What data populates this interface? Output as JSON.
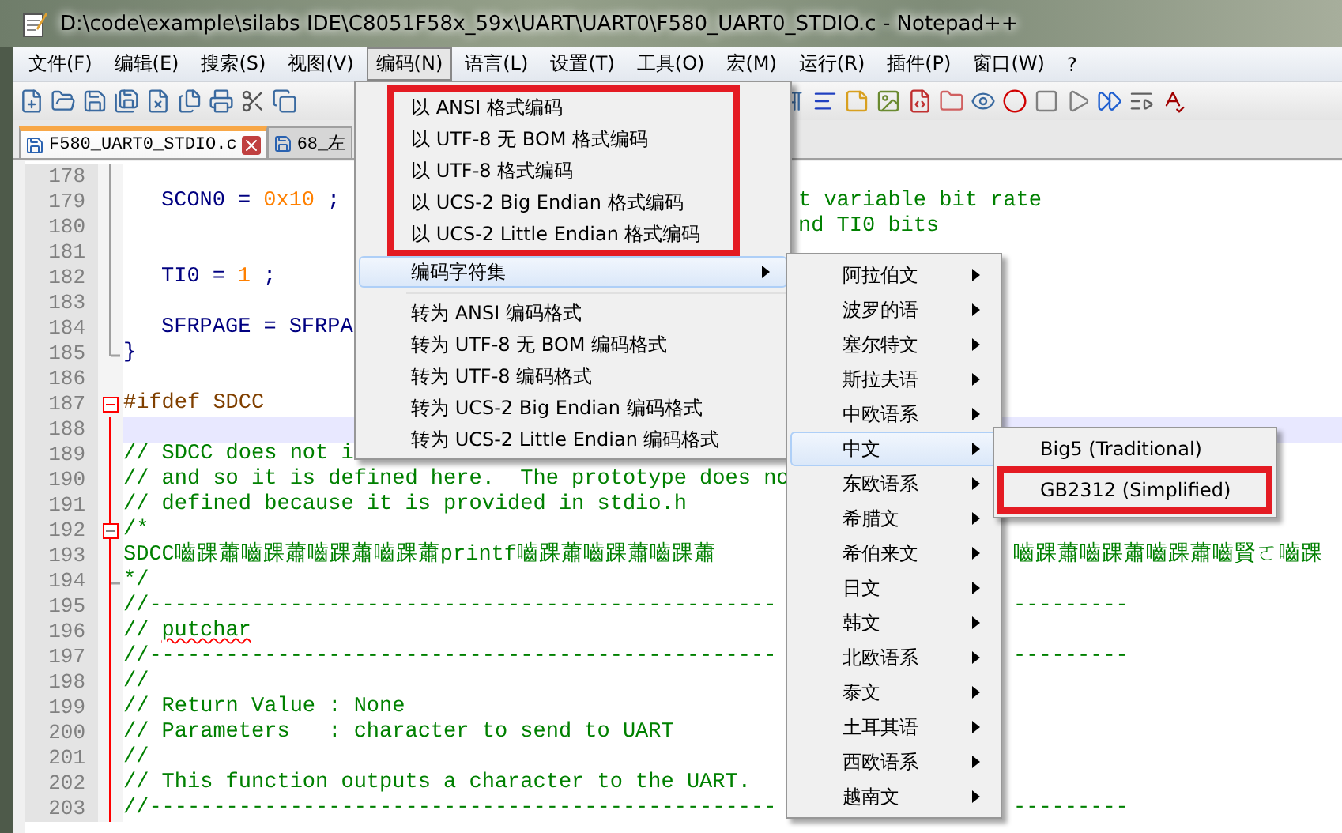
{
  "window": {
    "title": "D:\\code\\example\\silabs IDE\\C8051F58x_59x\\UART\\UART0\\F580_UART0_STDIO.c - Notepad++"
  },
  "menu_bar": [
    {
      "label": "文件(F)",
      "selected": false
    },
    {
      "label": "编辑(E)",
      "selected": false
    },
    {
      "label": "搜索(S)",
      "selected": false
    },
    {
      "label": "视图(V)",
      "selected": false
    },
    {
      "label": "编码(N)",
      "selected": true
    },
    {
      "label": "语言(L)",
      "selected": false
    },
    {
      "label": "设置(T)",
      "selected": false
    },
    {
      "label": "工具(O)",
      "selected": false
    },
    {
      "label": "宏(M)",
      "selected": false
    },
    {
      "label": "运行(R)",
      "selected": false
    },
    {
      "label": "插件(P)",
      "selected": false
    },
    {
      "label": "窗口(W)",
      "selected": false
    },
    {
      "label": "?",
      "selected": false
    }
  ],
  "tabs": [
    {
      "label": "F580_UART0_STDIO.c",
      "selected": true
    },
    {
      "label": "68_左",
      "selected": false
    }
  ],
  "editor": {
    "body_lines": [
      {
        "number": "178",
        "kind": "bar"
      },
      {
        "number": "179",
        "kind": "bar",
        "segments": [
          {
            "kind": "plain",
            "text": "SCON0"
          },
          {
            "kind": "op",
            "text": "="
          },
          {
            "kind": "number",
            "text": "0x10"
          },
          {
            "kind": "op",
            "text": ";"
          }
        ],
        "after_menu": [
          {
            "kind": "comment",
            "text": "t variable bit rate"
          }
        ]
      },
      {
        "number": "180",
        "kind": "bar",
        "after_menu": [
          {
            "kind": "comment",
            "text": "nd TI0 bits"
          }
        ]
      },
      {
        "number": "181",
        "kind": "bar"
      },
      {
        "number": "182",
        "kind": "bar",
        "segments": [
          {
            "kind": "plain",
            "text": "TI0"
          },
          {
            "kind": "op",
            "text": "="
          },
          {
            "kind": "number",
            "text": "1"
          },
          {
            "kind": "op",
            "text": ";"
          }
        ]
      },
      {
        "number": "183",
        "kind": "bar"
      },
      {
        "number": "184",
        "kind": "bar",
        "segments": [
          {
            "kind": "plain",
            "text": "SFRPAGE"
          },
          {
            "kind": "op",
            "text": "="
          },
          {
            "kind": "plain",
            "text": "SFRPA"
          }
        ]
      }
    ],
    "lines": [
      {
        "number": "185",
        "kind": "end",
        "segments": [
          {
            "kind": "op",
            "text": "}"
          }
        ]
      },
      {
        "number": "186",
        "kind": "plain"
      },
      {
        "number": "187",
        "kind": "box",
        "segments": [
          {
            "kind": "preproc",
            "text": "#ifdef SDCC"
          }
        ]
      },
      {
        "number": "188",
        "kind": "hot",
        "current": true
      },
      {
        "number": "189",
        "kind": "hot",
        "segments": [
          {
            "kind": "comment",
            "text": "// SDCC does not i"
          }
        ]
      },
      {
        "number": "190",
        "kind": "hot",
        "segments": [
          {
            "kind": "comment",
            "text": "// and so it is defined here.  The prototype does no"
          }
        ]
      },
      {
        "number": "191",
        "kind": "hot",
        "segments": [
          {
            "kind": "comment",
            "text": "// defined because it is provided in stdio.h"
          }
        ]
      },
      {
        "number": "192",
        "kind": "hotbox",
        "segments": [
          {
            "kind": "comment",
            "text": "/*"
          }
        ]
      },
      {
        "number": "193",
        "kind": "hot",
        "segments": [
          {
            "kind": "comment",
            "text": "SDCC嚙踝蕭嚙踝蕭嚙踝蕭嚙踝蕭printf嚙踝蕭嚙踝蕭嚙踝蕭"
          }
        ],
        "after_submenu": [
          {
            "kind": "comment",
            "text": "嚙踝蕭嚙踝蕭嚙踝蕭嚙賢ㄛ嚙踝"
          }
        ]
      },
      {
        "number": "194",
        "kind": "hotend",
        "segments": [
          {
            "kind": "comment",
            "text": "*/"
          }
        ]
      },
      {
        "number": "195",
        "kind": "hot",
        "segments": [
          {
            "kind": "comment",
            "text": "//-------------------------------------------------"
          }
        ],
        "after_submenu": [
          {
            "kind": "comment",
            "text": "---------"
          }
        ]
      },
      {
        "number": "196",
        "kind": "hot",
        "segments": [
          {
            "kind": "comment",
            "text": "//"
          },
          {
            "kind": "misspelled",
            "text": "putchar"
          }
        ]
      },
      {
        "number": "197",
        "kind": "hot",
        "segments": [
          {
            "kind": "comment",
            "text": "//-------------------------------------------------"
          }
        ],
        "after_submenu": [
          {
            "kind": "comment",
            "text": "---------"
          }
        ]
      },
      {
        "number": "198",
        "kind": "hot",
        "segments": [
          {
            "kind": "comment",
            "text": "//"
          }
        ]
      },
      {
        "number": "199",
        "kind": "hot",
        "segments": [
          {
            "kind": "comment",
            "text": "// Return Value : None"
          }
        ]
      },
      {
        "number": "200",
        "kind": "hot",
        "segments": [
          {
            "kind": "comment",
            "text": "// Parameters   : character to send to UART"
          }
        ]
      },
      {
        "number": "201",
        "kind": "hot",
        "segments": [
          {
            "kind": "comment",
            "text": "//"
          }
        ]
      },
      {
        "number": "202",
        "kind": "hot",
        "segments": [
          {
            "kind": "comment",
            "text": "// This function outputs a character to the UART."
          }
        ]
      },
      {
        "number": "203",
        "kind": "hot",
        "segments": [
          {
            "kind": "comment",
            "text": "//-------------------------------------------------"
          }
        ],
        "after_submenu": [
          {
            "kind": "comment",
            "text": "---------"
          }
        ]
      }
    ]
  },
  "encoding_menu": {
    "items": [
      {
        "kind": "item",
        "label": "以 ANSI 格式编码",
        "highlighted": false,
        "framed": true
      },
      {
        "kind": "item",
        "label": "以 UTF-8 无 BOM 格式编码",
        "highlighted": false,
        "framed": true
      },
      {
        "kind": "item",
        "label": "以 UTF-8 格式编码",
        "highlighted": false,
        "framed": true
      },
      {
        "kind": "item",
        "label": "以 UCS-2 Big Endian 格式编码",
        "highlighted": false,
        "framed": true
      },
      {
        "kind": "item",
        "label": "以 UCS-2 Little Endian 格式编码",
        "highlighted": false,
        "framed": true
      },
      {
        "kind": "submenu",
        "label": "编码字符集",
        "highlighted": true,
        "framed": false
      },
      {
        "kind": "separator"
      },
      {
        "kind": "item",
        "label": "转为 ANSI 编码格式",
        "highlighted": false,
        "framed": false
      },
      {
        "kind": "item",
        "label": "转为 UTF-8 无 BOM 编码格式",
        "highlighted": false,
        "framed": false
      },
      {
        "kind": "item",
        "label": "转为 UTF-8 编码格式",
        "highlighted": false,
        "framed": false
      },
      {
        "kind": "item",
        "label": "转为 UCS-2 Big Endian 编码格式",
        "highlighted": false,
        "framed": false
      },
      {
        "kind": "item",
        "label": "转为 UCS-2 Little Endian 编码格式",
        "highlighted": false,
        "framed": false
      }
    ]
  },
  "charset_submenu": {
    "items": [
      {
        "kind": "submenu",
        "label": "阿拉伯文",
        "highlighted": false
      },
      {
        "kind": "submenu",
        "label": "波罗的语",
        "highlighted": false
      },
      {
        "kind": "submenu",
        "label": "塞尔特文",
        "highlighted": false
      },
      {
        "kind": "submenu",
        "label": "斯拉夫语",
        "highlighted": false
      },
      {
        "kind": "submenu",
        "label": "中欧语系",
        "highlighted": false
      },
      {
        "kind": "submenu",
        "label": "中文",
        "highlighted": true
      },
      {
        "kind": "submenu",
        "label": "东欧语系",
        "highlighted": false
      },
      {
        "kind": "submenu",
        "label": "希腊文",
        "highlighted": false
      },
      {
        "kind": "submenu",
        "label": "希伯来文",
        "highlighted": false
      },
      {
        "kind": "submenu",
        "label": "日文",
        "highlighted": false
      },
      {
        "kind": "submenu",
        "label": "韩文",
        "highlighted": false
      },
      {
        "kind": "submenu",
        "label": "北欧语系",
        "highlighted": false
      },
      {
        "kind": "submenu",
        "label": "泰文",
        "highlighted": false
      },
      {
        "kind": "submenu",
        "label": "土耳其语",
        "highlighted": false
      },
      {
        "kind": "submenu",
        "label": "西欧语系",
        "highlighted": false
      },
      {
        "kind": "submenu",
        "label": "越南文",
        "highlighted": false
      }
    ]
  },
  "chinese_submenu": {
    "items": [
      {
        "kind": "item",
        "label": "Big5 (Traditional)",
        "highlighted": false,
        "framed": false
      },
      {
        "kind": "item",
        "label": "GB2312 (Simplified)",
        "highlighted": false,
        "framed": true
      }
    ]
  }
}
